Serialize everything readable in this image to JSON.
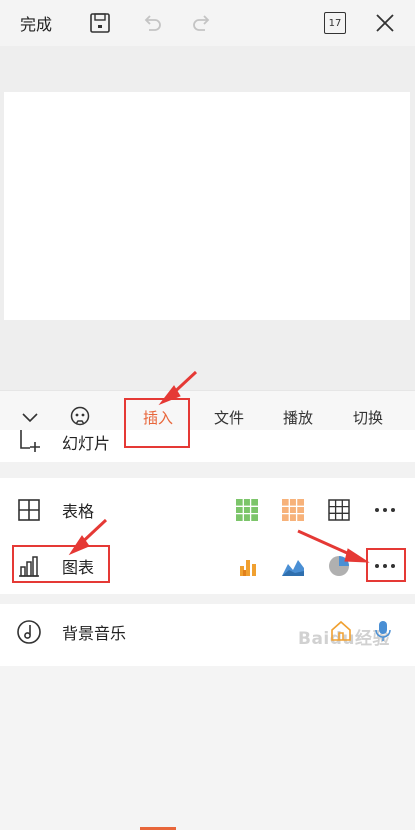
{
  "toolbar": {
    "done_label": "完成",
    "calendar_day": "17"
  },
  "tabs": [
    {
      "label": "插入",
      "active": true
    },
    {
      "label": "文件",
      "active": false
    },
    {
      "label": "播放",
      "active": false
    },
    {
      "label": "切换",
      "active": false
    }
  ],
  "panel": {
    "slide_label": "幻灯片",
    "table_label": "表格",
    "chart_label": "图表",
    "music_label": "背景音乐"
  },
  "watermark": "Baidu经验",
  "colors": {
    "accent": "#e8663a",
    "annotation_red": "#e53935",
    "table_green": "#5cb85c",
    "table_orange": "#f5a05a",
    "chart_orange": "#f0a030",
    "chart_blue": "#4a8fd4"
  }
}
